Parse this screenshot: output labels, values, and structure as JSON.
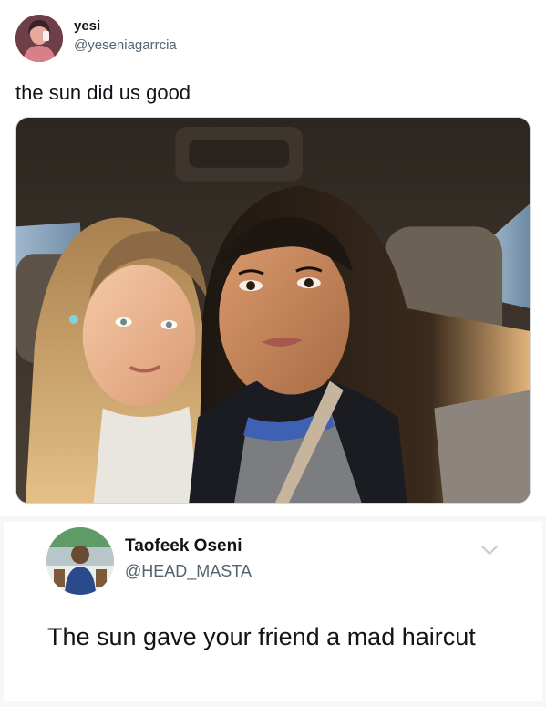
{
  "tweet": {
    "display_name": "yesi",
    "handle": "@yeseniagarrcia",
    "text": "the sun did us good",
    "avatar_icon": "user-avatar",
    "photo_icon": "selfie-photo"
  },
  "reply": {
    "display_name": "Taofeek Oseni",
    "handle": "@HEAD_MASTA",
    "text": "The sun gave your friend a mad haircut",
    "avatar_icon": "user-avatar",
    "more_icon": "chevron-down-icon"
  },
  "colors": {
    "text_primary": "#0f1419",
    "text_secondary": "#536471",
    "border": "#cfd9de",
    "background": "#ffffff"
  }
}
